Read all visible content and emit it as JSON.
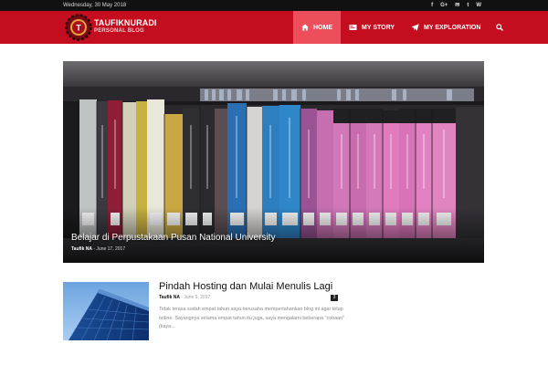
{
  "topbar": {
    "date": "Wednesday, 30 May 2018",
    "social": [
      {
        "icon": "facebook-icon",
        "glyph": "f"
      },
      {
        "icon": "google-plus-icon",
        "glyph": "G+"
      },
      {
        "icon": "mail-icon",
        "glyph": "✉"
      },
      {
        "icon": "twitter-icon",
        "glyph": "t"
      },
      {
        "icon": "wordpress-icon",
        "glyph": "W"
      }
    ]
  },
  "header": {
    "brand_name": "TAUFIKNURADI",
    "brand_tagline": "PERSONAL BLOG",
    "colors": {
      "bar": "#c40d1f",
      "active": "#ec4e5c"
    },
    "nav": [
      {
        "label": "HOME",
        "icon": "home-icon",
        "active": true
      },
      {
        "label": "MY STORY",
        "icon": "book-icon",
        "active": false
      },
      {
        "label": "MY EXPLORATION",
        "icon": "paper-plane-icon",
        "active": false
      }
    ],
    "search_icon": "search-icon"
  },
  "hero": {
    "title": "Belajar di Perpustakaan Pusan National University",
    "author": "Taufik NA",
    "date": "June 17, 2017"
  },
  "post": {
    "title": "Pindah Hosting dan Mulai Menulis Lagi",
    "author": "Taufik NA",
    "date": "June 9, 2017",
    "comments": "3",
    "excerpt": "Tidak terasa sudah empat tahun saya berusaha mempertahankan blog ini agar tetap online. Sayangnya selama empat tahun itu juga, saya mengalami beberapa \"cobaan\" (kaya..."
  }
}
